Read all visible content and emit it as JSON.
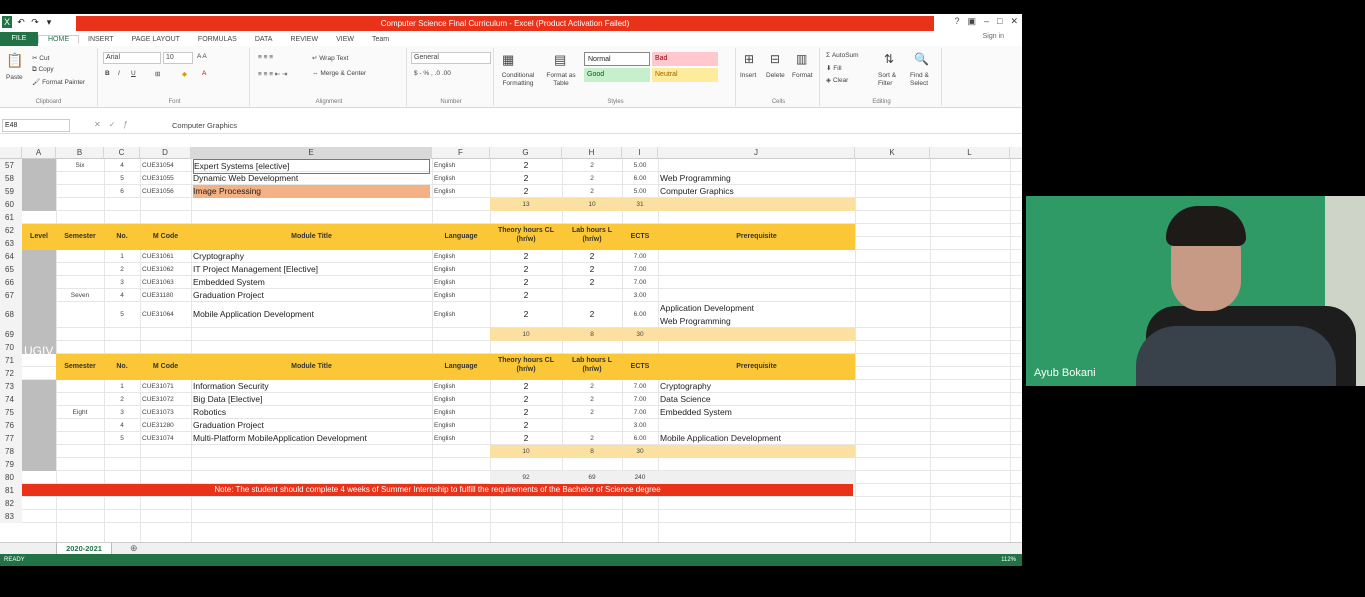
{
  "window": {
    "title": "Computer Science Final Curriculum - Excel (Product Activation Failed)",
    "file_tab": "FILE",
    "tabs": [
      "HOME",
      "INSERT",
      "PAGE LAYOUT",
      "FORMULAS",
      "DATA",
      "REVIEW",
      "VIEW",
      "Team"
    ],
    "sign_in": "Sign in"
  },
  "ribbon": {
    "paste": "Paste",
    "cut": "Cut",
    "copy": "Copy",
    "format_painter": "Format Painter",
    "font_name": "Arial",
    "font_size": "10",
    "wrap_text": "Wrap Text",
    "merge_center": "Merge & Center",
    "number_format": "General",
    "cond_format": "Conditional Formatting",
    "format_table": "Format as Table",
    "styles": {
      "normal": "Normal",
      "bad": "Bad",
      "good": "Good",
      "neutral": "Neutral"
    },
    "insert": "Insert",
    "delete": "Delete",
    "format": "Format",
    "autosum": "AutoSum",
    "fill": "Fill",
    "clear": "Clear",
    "sort_filter": "Sort & Filter",
    "find_select": "Find & Select",
    "groups": [
      "Clipboard",
      "Font",
      "Alignment",
      "Number",
      "Styles",
      "Cells",
      "Editing"
    ]
  },
  "formula_bar": {
    "name_box": "E48",
    "value": "Computer Graphics"
  },
  "columns": [
    "A",
    "B",
    "C",
    "D",
    "E",
    "F",
    "G",
    "H",
    "I",
    "J",
    "K",
    "L"
  ],
  "rows": [
    "57",
    "58",
    "59",
    "60",
    "61",
    "62",
    "63",
    "64",
    "65",
    "66",
    "67",
    "68",
    "69",
    "70",
    "71",
    "72",
    "73",
    "74",
    "75",
    "76",
    "77",
    "78",
    "79",
    "80",
    "81",
    "82",
    "83"
  ],
  "block6": {
    "semester": "Six",
    "items": [
      {
        "no": "4",
        "code": "CUE31054",
        "title": "Expert Systems  [elective]",
        "lang": "English",
        "theory": "2",
        "lab": "2",
        "ects": "5.00",
        "prereq": ""
      },
      {
        "no": "5",
        "code": "CUE31055",
        "title": "Dynamic Web Development",
        "lang": "English",
        "theory": "2",
        "lab": "2",
        "ects": "6.00",
        "prereq": "Web Programming"
      },
      {
        "no": "6",
        "code": "CUE31056",
        "title": "Image Processing",
        "lang": "English",
        "theory": "2",
        "lab": "2",
        "ects": "5.00",
        "prereq": "Computer Graphics"
      }
    ],
    "totals": {
      "theory": "13",
      "lab": "10",
      "ects": "31"
    }
  },
  "header": {
    "level": "Level",
    "semester": "Semester",
    "no": "No.",
    "code": "M Code",
    "title": "Module Title",
    "language": "Language",
    "theory": "Theory hours CL (hr/w)",
    "lab": "Lab hours L (hr/w)",
    "ects": "ECTS",
    "prereq": "Prerequisite"
  },
  "block7": {
    "semester": "Seven",
    "items": [
      {
        "no": "1",
        "code": "CUE31061",
        "title": "Cryptography",
        "lang": "English",
        "theory": "2",
        "lab": "2",
        "ects": "7.00",
        "prereq": ""
      },
      {
        "no": "2",
        "code": "CUE31062",
        "title": "IT Project Management [Elective]",
        "lang": "English",
        "theory": "2",
        "lab": "2",
        "ects": "7.00",
        "prereq": ""
      },
      {
        "no": "3",
        "code": "CUE31063",
        "title": "Embedded System",
        "lang": "English",
        "theory": "2",
        "lab": "2",
        "ects": "7.00",
        "prereq": ""
      },
      {
        "no": "4",
        "code": "CUE31180",
        "title": "Graduation Project",
        "lang": "English",
        "theory": "2",
        "lab": "",
        "ects": "3.00",
        "prereq": ""
      },
      {
        "no": "5",
        "code": "CUE31064",
        "title": "Mobile Application Development",
        "lang": "English",
        "theory": "2",
        "lab": "2",
        "ects": "6.00",
        "prereq": "Application Development",
        "prereq2": "Web Programming"
      }
    ],
    "totals": {
      "theory": "10",
      "lab": "8",
      "ects": "30"
    }
  },
  "level_label": "UGIV",
  "block8": {
    "semester": "Eight",
    "items": [
      {
        "no": "1",
        "code": "CUE31071",
        "title": "Information Security",
        "lang": "English",
        "theory": "2",
        "lab": "2",
        "ects": "7.00",
        "prereq": "Cryptography"
      },
      {
        "no": "2",
        "code": "CUE31072",
        "title": "Big Data [Elective]",
        "lang": "English",
        "theory": "2",
        "lab": "2",
        "ects": "7.00",
        "prereq": "Data Science"
      },
      {
        "no": "3",
        "code": "CUE31073",
        "title": "Robotics",
        "lang": "English",
        "theory": "2",
        "lab": "2",
        "ects": "7.00",
        "prereq": "Embedded System"
      },
      {
        "no": "4",
        "code": "CUE31280",
        "title": "Graduation Project",
        "lang": "English",
        "theory": "2",
        "lab": "",
        "ects": "3.00",
        "prereq": ""
      },
      {
        "no": "5",
        "code": "CUE31074",
        "title": "Multi-Platform MobileApplication Development",
        "lang": "English",
        "theory": "2",
        "lab": "2",
        "ects": "6.00",
        "prereq": "Mobile Application Development"
      }
    ],
    "totals": {
      "theory": "10",
      "lab": "8",
      "ects": "30"
    }
  },
  "grand_totals": {
    "theory": "92",
    "lab": "69",
    "ects": "240"
  },
  "note": "Note: The student should complete 4 weeks of Summer Internship to fulfill the requirements of the Bachelor of Science degree",
  "sheet_tab": "2020-2021",
  "status": {
    "ready": "READY",
    "zoom": "112%"
  },
  "video": {
    "participant": "Ayub Bokani"
  },
  "colors": {
    "excel_green": "#217346",
    "title_red": "#e8321a",
    "header_yellow": "#fcc736",
    "sum_yellow": "#fbe0a2"
  }
}
